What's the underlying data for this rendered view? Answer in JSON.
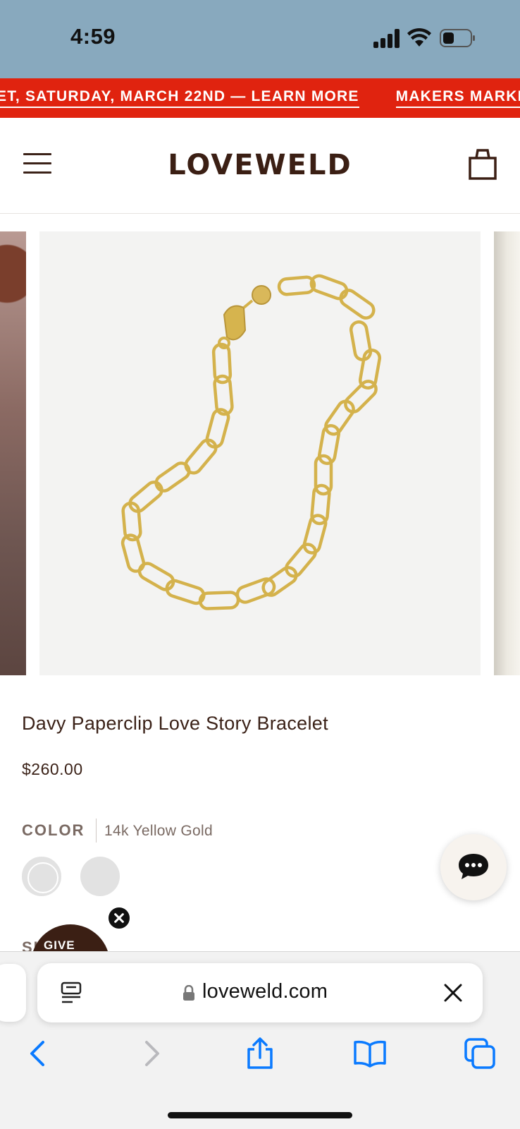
{
  "status_bar": {
    "time": "4:59"
  },
  "announcement": {
    "segments": [
      {
        "text": "ET, SATURDAY, MARCH 22ND — ",
        "link": "LEARN MORE"
      },
      {
        "text": "MAKERS MARKET,",
        "link": ""
      }
    ],
    "background_color": "#e0230f"
  },
  "header": {
    "logo": "LOVEWELD"
  },
  "product": {
    "title": "Davy Paperclip Love Story Bracelet",
    "price": "$260.00",
    "color_label": "COLOR",
    "color_value": "14k Yellow Gold",
    "swatches": [
      "14k Yellow Gold",
      "Silver"
    ],
    "next_option_label": "SI"
  },
  "promo": {
    "label": "GIVE"
  },
  "browser": {
    "url": "loveweld.com"
  },
  "icons": {
    "menu": "hamburger-icon",
    "cart": "shopping-bag-icon",
    "chat": "chat-icon",
    "close": "close-icon"
  },
  "colors": {
    "brand_brown": "#3b1f14",
    "status_bar_bg": "#88a9be",
    "ios_blue": "#0a7aff"
  }
}
